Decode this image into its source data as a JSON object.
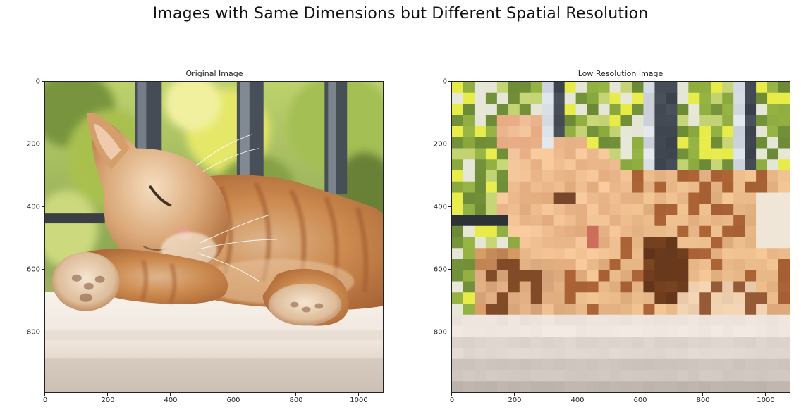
{
  "figure": {
    "suptitle": "Images with Same Dimensions but Different Spatial Resolution"
  },
  "panels": [
    {
      "title": "Original Image",
      "image_description": "orange tabby cat lying on its side with eyes closed on a sunny surface, green foliage and dark metal railing bars behind",
      "x_ticks": [
        "0",
        "200",
        "400",
        "600",
        "800",
        "1000"
      ],
      "y_ticks": [
        "0",
        "200",
        "400",
        "600",
        "800"
      ],
      "x_range": [
        0,
        1080
      ],
      "y_range": [
        0,
        1000
      ]
    },
    {
      "title": "Low Resolution Image",
      "image_description": "same cat image heavily pixelated into large square blocks",
      "x_ticks": [
        "0",
        "200",
        "400",
        "600",
        "800",
        "1000"
      ],
      "y_ticks": [
        "0",
        "200",
        "400",
        "600",
        "800"
      ],
      "x_range": [
        0,
        1080
      ],
      "y_range": [
        0,
        1000
      ]
    }
  ],
  "colors": {
    "fur_orange": "#c87a3a",
    "fur_light": "#f1d2a8",
    "foliage_green": "#8fae3a",
    "foliage_yellow": "#d9dd4e",
    "railing_dark": "#3f4650",
    "ground_light": "#f4ede6",
    "ground_shadow": "#cbbfb4"
  }
}
